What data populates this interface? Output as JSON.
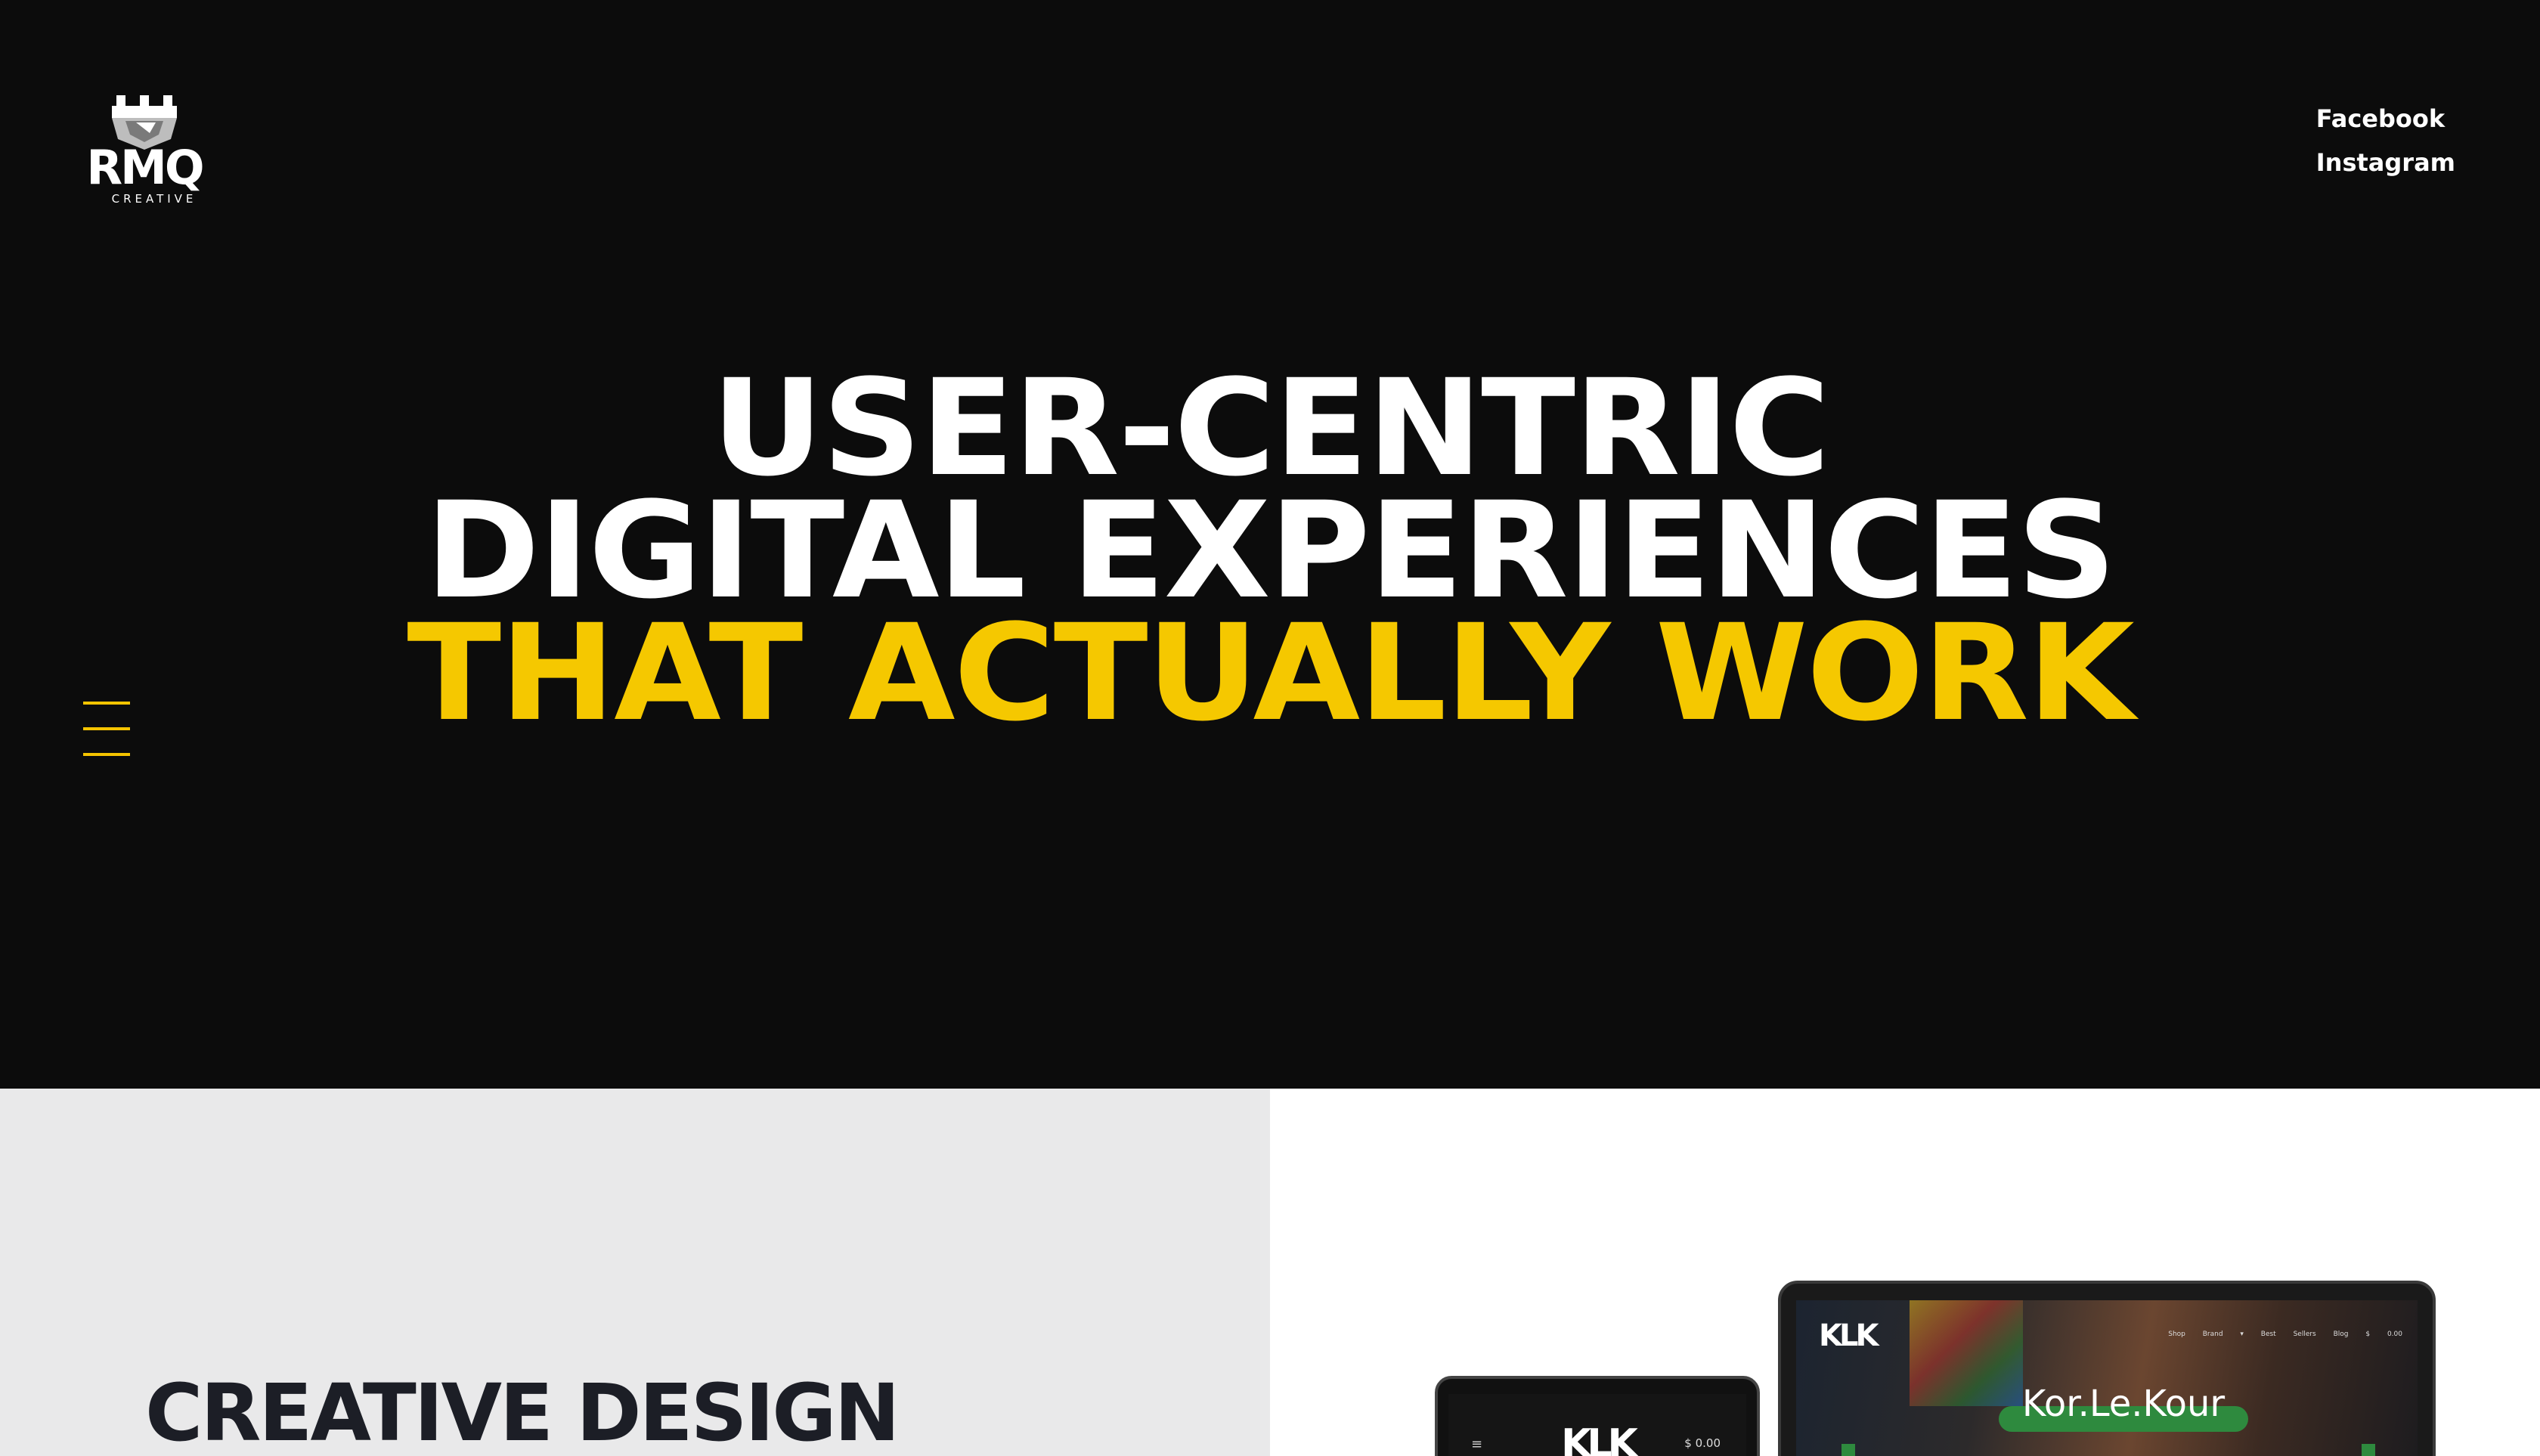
{
  "brand": {
    "name": "RMQ",
    "tagline": "CREATIVE"
  },
  "social": [
    {
      "label": "Facebook"
    },
    {
      "label": "Instagram"
    }
  ],
  "hero": {
    "line1": "USER-CENTRIC",
    "line2": "DIGITAL EXPERIENCES",
    "line3": "THAT ACTUALLY WORK"
  },
  "section": {
    "title": "CREATIVE DESIGN"
  },
  "showcase": {
    "laptop_logo": "KLK",
    "laptop_nav": "Shop Brand ▾ Best Sellers Blog $ 0.00",
    "banner_text": "Kor.Le.Kour",
    "tablet_logo": "KLK",
    "tablet_cart": "$ 0.00"
  },
  "colors": {
    "accent": "#f5c800",
    "background": "#0c0c0c",
    "panel": "#e9e9ea",
    "title": "#1c1e26"
  },
  "icons": {
    "menu": "hamburger-icon",
    "logo": "rmq-shield-icon",
    "cart": "cart-icon"
  }
}
